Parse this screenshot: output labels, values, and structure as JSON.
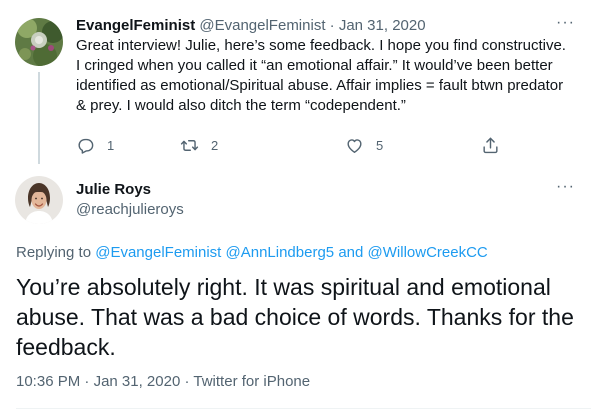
{
  "parent_tweet": {
    "display_name": "EvangelFeminist",
    "handle": "@EvangelFeminist",
    "separator": "·",
    "date": "Jan 31, 2020",
    "more": "···",
    "text": "Great interview! Julie, here’s some feedback. I hope you find constructive. I cringed when you called it “an emotional affair.” It would’ve been better identified as emotional/Spiritual abuse. Affair implies = fault btwn predator & prey. I would also ditch the term “codependent.”",
    "actions": {
      "reply_icon": "reply-icon",
      "reply_count": "1",
      "retweet_icon": "retweet-icon",
      "retweet_count": "2",
      "like_icon": "like-icon",
      "like_count": "5",
      "share_icon": "share-icon"
    }
  },
  "focused_tweet": {
    "display_name": "Julie Roys",
    "handle": "@reachjulieroys",
    "more": "···",
    "replying_prefix": "Replying to",
    "replying_user_1": "@EvangelFeminist",
    "replying_user_2": "@AnnLindberg5",
    "replying_and": "and",
    "replying_user_3": "@WillowCreekCC",
    "text": "You’re absolutely right. It was spiritual and emotional abuse. That was a bad choice of words. Thanks for the feedback.",
    "time": "10:36 PM",
    "date": "Jan 31, 2020",
    "source": "Twitter for iPhone",
    "separator": "·"
  },
  "colors": {
    "link": "#1d9bf0",
    "secondary_text": "#536471",
    "primary_text": "#0f1419"
  }
}
